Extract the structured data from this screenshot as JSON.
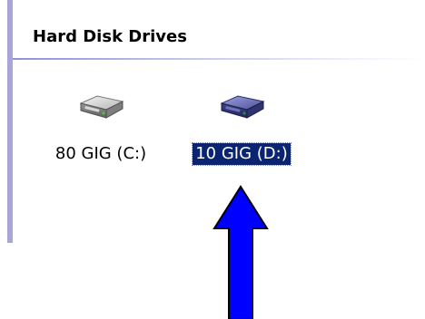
{
  "section": {
    "title": "Hard Disk Drives"
  },
  "drives": [
    {
      "label": "80 GIG (C:)",
      "selected": false,
      "icon": "hard-drive-icon"
    },
    {
      "label": "10 GIG (D:)",
      "selected": true,
      "icon": "hard-drive-icon"
    }
  ],
  "colors": {
    "selection": "#0b2472",
    "arrow": "#0000ff",
    "selected_drive_icon": "#4a4f9a",
    "drive_icon": "#9a9a9a"
  },
  "annotation": {
    "icon": "up-arrow-icon"
  }
}
